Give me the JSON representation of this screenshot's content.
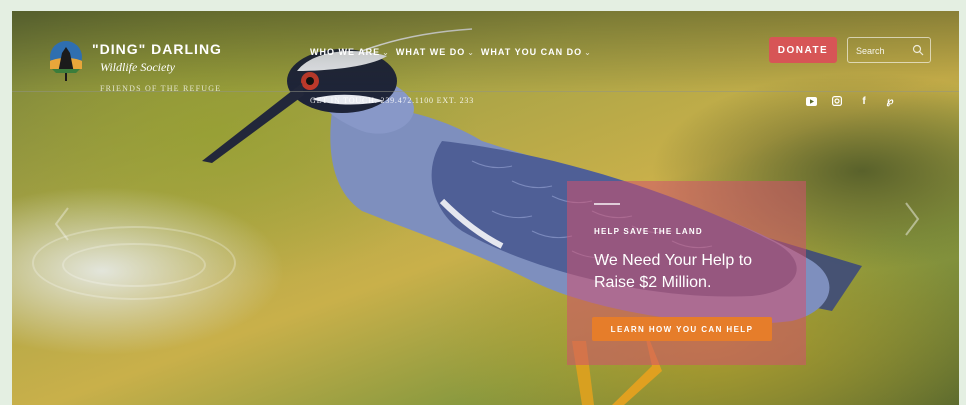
{
  "brand": {
    "name": "\"DING\" DARLING",
    "subtitle": "Wildlife Society",
    "tagline": "FRIENDS OF THE REFUGE"
  },
  "nav": {
    "items": [
      {
        "label": "WHO WE ARE"
      },
      {
        "label": "WHAT WE DO"
      },
      {
        "label": "WHAT YOU CAN DO"
      }
    ]
  },
  "contact": {
    "text": "GET IN TOUCH: 239.472.1100 EXT. 233"
  },
  "donate_label": "DONATE",
  "search": {
    "placeholder": "Search"
  },
  "social": [
    {
      "icon": "youtube-icon"
    },
    {
      "icon": "instagram-icon"
    },
    {
      "icon": "facebook-icon"
    },
    {
      "icon": "pinterest-icon"
    }
  ],
  "hero_card": {
    "eyebrow": "HELP SAVE THE LAND",
    "headline": "We Need Your Help to Raise $2 Million.",
    "button_label": "LEARN HOW YOU CAN HELP"
  },
  "colors": {
    "donate": "#d75556",
    "card": "#d2506e",
    "card_button": "#e67d2a"
  }
}
